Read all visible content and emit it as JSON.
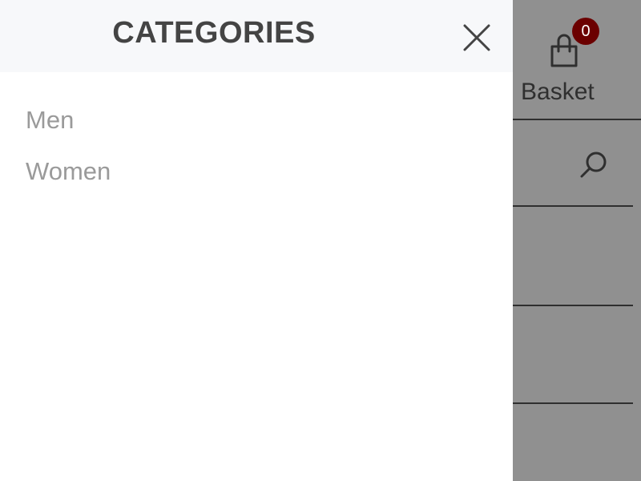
{
  "drawer": {
    "title": "CATEGORIES",
    "close_icon": "close-icon",
    "categories": [
      {
        "label": "Men"
      },
      {
        "label": "Women"
      }
    ]
  },
  "header": {
    "basket": {
      "label": "Basket",
      "count": "0",
      "icon": "shopping-bag-icon"
    },
    "search": {
      "icon": "search-icon"
    }
  },
  "colors": {
    "overlay": "#909090",
    "drawer_header_bg": "#f7f8fa",
    "badge_bg": "#6b0000",
    "category_text": "#9a9a9a",
    "title_text": "#444444"
  }
}
